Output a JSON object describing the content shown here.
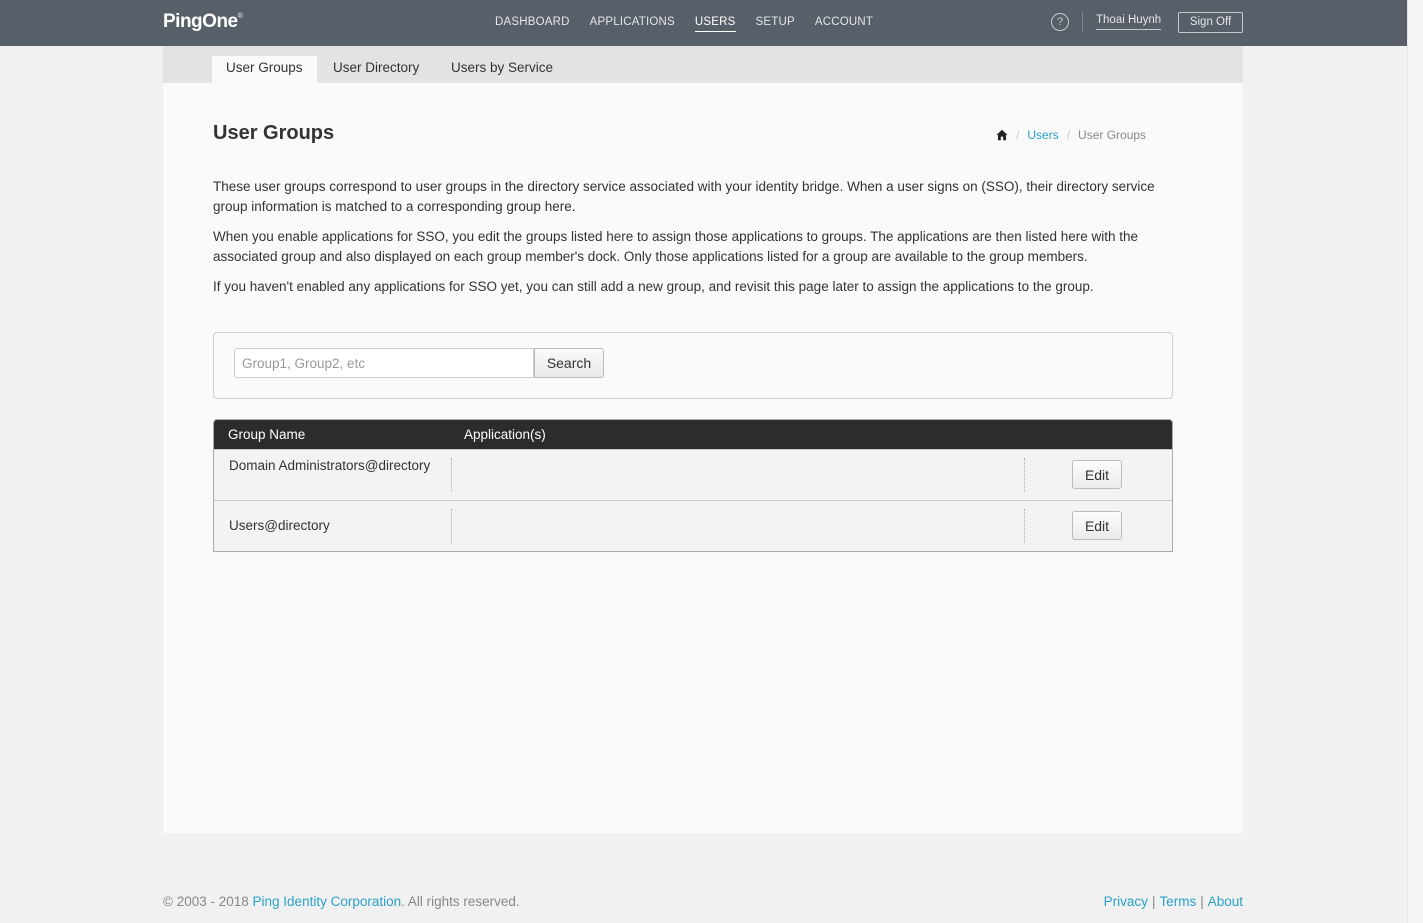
{
  "topnav": {
    "logo": "PingOne",
    "logo_mark": "®",
    "items": [
      "DASHBOARD",
      "APPLICATIONS",
      "USERS",
      "SETUP",
      "ACCOUNT"
    ],
    "help_icon": "?",
    "user_name": "Thoai Huynh",
    "signoff_label": "Sign Off"
  },
  "subtabs": [
    "User Groups",
    "User Directory",
    "Users by Service"
  ],
  "page": {
    "title": "User Groups",
    "breadcrumb": {
      "home_icon": "home-icon",
      "users": "Users",
      "current": "User Groups",
      "separator": "/"
    },
    "paragraphs": [
      "These user groups correspond to user groups in the directory service associated with your identity bridge. When a user signs on (SSO), their directory service group information is matched to a corresponding group here.",
      "When you enable applications for SSO, you edit the groups listed here to assign those applications to groups. The applications are then listed here with the associated group and also displayed on each group member's dock. Only those applications listed for a group are available to the group members.",
      "If you haven't enabled any applications for SSO yet, you can still add a new group, and revisit this page later to assign the applications to the group."
    ]
  },
  "search": {
    "placeholder": "Group1, Group2, etc",
    "button_label": "Search"
  },
  "table": {
    "headers": [
      "Group Name",
      "Application(s)"
    ],
    "rows": [
      {
        "name": "Domain Administrators@directory",
        "applications": "",
        "action": "Edit"
      },
      {
        "name": "Users@directory",
        "applications": "",
        "action": "Edit"
      }
    ]
  },
  "footer": {
    "copyright": "© 2003 - 2018",
    "company": "Ping Identity Corporation",
    "rights": ". All rights reserved.",
    "links": [
      "Privacy",
      "Terms",
      "About"
    ],
    "separator": "|"
  }
}
